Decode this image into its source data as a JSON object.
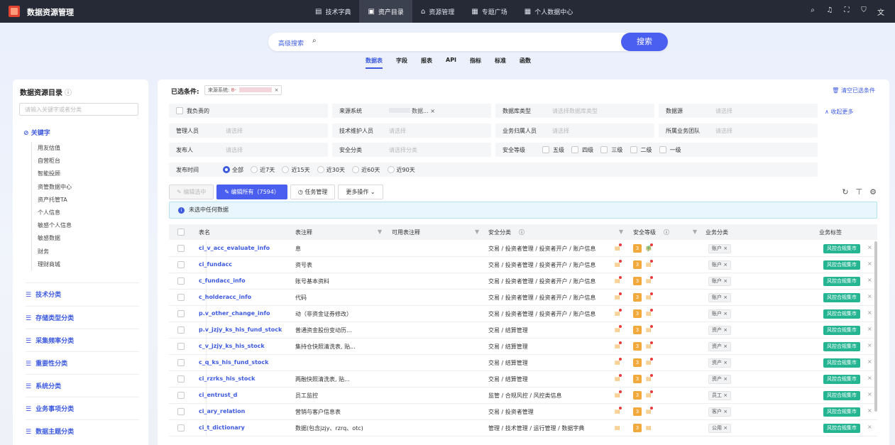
{
  "app": {
    "title": "数据资源管理"
  },
  "nav": [
    {
      "icon": "▤",
      "label": "技术字典"
    },
    {
      "icon": "▣",
      "label": "资产目录"
    },
    {
      "icon": "⌂",
      "label": "资源管理"
    },
    {
      "icon": "▦",
      "label": "专题广场"
    },
    {
      "icon": "▦",
      "label": "个人数据中心"
    }
  ],
  "top_icons": [
    "⌕",
    "♫",
    "⛶",
    "⛉",
    "文"
  ],
  "search": {
    "advanced": "高级搜索",
    "placeholder": "",
    "button": "搜索"
  },
  "type_tabs": [
    "数据表",
    "字段",
    "报表",
    "API",
    "指标",
    "标准",
    "函数"
  ],
  "sidebar": {
    "title": "数据资源目录",
    "search_placeholder": "请输入关键字或者分类",
    "keyword_label": "关键字",
    "keywords": [
      "用友估值",
      "自营柜台",
      "智能投顾",
      "资管数据中心",
      "资产托管TA",
      "个人信息",
      "敏感个人信息",
      "敏感数据",
      "财务",
      "理财商城"
    ],
    "categories": [
      "技术分类",
      "存储类型分类",
      "采集频率分类",
      "重要性分类",
      "系统分类",
      "业务事项分类",
      "数据主题分类"
    ]
  },
  "filters": {
    "selected_label": "已选条件:",
    "selected_chip": {
      "key": "来源系统:",
      "value": "8-"
    },
    "clear_all": "清空已选条件",
    "collapse": "收起更多",
    "mine": "我负责的",
    "row1": [
      {
        "label": "来源系统",
        "value": "数据..."
      },
      {
        "label": "数据库类型",
        "placeholder": "请选择数据库类型"
      },
      {
        "label": "数据源",
        "placeholder": "请选择"
      }
    ],
    "row2": [
      {
        "label": "管理人员",
        "placeholder": "请选择"
      },
      {
        "label": "技术维护人员",
        "placeholder": "请选择"
      },
      {
        "label": "业务归属人员",
        "placeholder": "请选择"
      },
      {
        "label": "所属业务团队",
        "placeholder": "请选择"
      }
    ],
    "row3": [
      {
        "label": "发布人",
        "placeholder": "请选择"
      },
      {
        "label": "安全分类",
        "placeholder": "请选择分类"
      }
    ],
    "security_level": {
      "label": "安全等级",
      "options": [
        "五级",
        "四级",
        "三级",
        "二级",
        "一级"
      ]
    },
    "publish_time": {
      "label": "发布时间",
      "options": [
        "全部",
        "近7天",
        "近15天",
        "近30天",
        "近60天",
        "近90天"
      ],
      "selected": "全部"
    }
  },
  "toolbar": {
    "edit_selected": "编辑选中",
    "edit_all": "编辑所有（7594）",
    "tasks": "任务管理",
    "more": "更多操作"
  },
  "toolbar_icons": [
    "↻",
    "⊤",
    "⚙"
  ],
  "notice": "未选中任何数据",
  "table": {
    "headers": {
      "name": "表名",
      "comment": "表注释",
      "available": "可用表注释",
      "security_class": "安全分类",
      "security_level": "安全等级",
      "biz_class": "业务分类",
      "biz_tag": "业务标签"
    },
    "rows": [
      {
        "name": "ci_v_acc_evaluate_info",
        "comment": "息",
        "class": "交易 / 投资者管理 / 投资者开户 / 账户信息",
        "level": "3",
        "mark": "手",
        "biz": "账户",
        "tag": "风控合规集市"
      },
      {
        "name": "ci_fundacc",
        "comment": "资号表",
        "class": "交易 / 投资者管理 / 投资者开户 / 账户信息",
        "level": "3",
        "mark": "",
        "biz": "账户",
        "tag": "风控合规集市"
      },
      {
        "name": "c_fundacc_info",
        "comment": "账号基本资料",
        "class": "交易 / 投资者管理 / 投资者开户 / 账户信息",
        "level": "3",
        "mark": "",
        "biz": "账户",
        "tag": "风控合规集市"
      },
      {
        "name": "c_holderacc_info",
        "comment": "代码",
        "class": "交易 / 投资者管理 / 投资者开户 / 账户信息",
        "level": "3",
        "mark": "",
        "biz": "账户",
        "tag": "风控合规集市"
      },
      {
        "name": "p.v_other_change_info",
        "comment": "动（非资金证券修改）",
        "class": "交易 / 投资者管理 / 投资者开户 / 账户信息",
        "level": "3",
        "mark": "",
        "biz": "账户",
        "tag": "风控合规集市"
      },
      {
        "name": "p.v_jzjy_ks_his_fund_stock",
        "comment": "普通资金股份变动历...",
        "class": "交易 / 结算管理",
        "level": "3",
        "mark": "",
        "biz": "资产",
        "tag": "风控合规集市"
      },
      {
        "name": "c_v_jzjy_ks_his_stock",
        "comment": "集持仓快照清洗表, 贴...",
        "class": "交易 / 结算管理",
        "level": "3",
        "mark": "",
        "biz": "资产",
        "tag": "风控合规集市"
      },
      {
        "name": "c_q_ks_his_fund_stock",
        "comment": "",
        "class": "交易 / 结算管理",
        "level": "3",
        "mark": "",
        "biz": "资产",
        "tag": "风控合规集市"
      },
      {
        "name": "ci_rzrks_his_stock",
        "comment": "两融快照清洗表, 贴...",
        "class": "交易 / 结算管理",
        "level": "3",
        "mark": "",
        "biz": "资产",
        "tag": "风控合规集市"
      },
      {
        "name": "ci_entrust_d",
        "comment": "员工监控",
        "class": "监管 / 合规风控 / 风控类信息",
        "level": "3",
        "mark": "",
        "biz": "员工",
        "tag": "风控合规集市"
      },
      {
        "name": "ci_ary_relation",
        "comment": "营销与客户信息表",
        "class": "交易 / 投资者管理",
        "level": "3",
        "mark": "",
        "biz": "客户",
        "tag": "风控合规集市"
      },
      {
        "name": "ci_t_dictionary",
        "comment": "数据(包含jzjy、rzrq、otc)",
        "class": "管理 / 技术管理 / 运行管理 / 数据字典",
        "level": "3",
        "mark": "",
        "biz": "公用",
        "tag": "风控合规集市"
      }
    ]
  }
}
